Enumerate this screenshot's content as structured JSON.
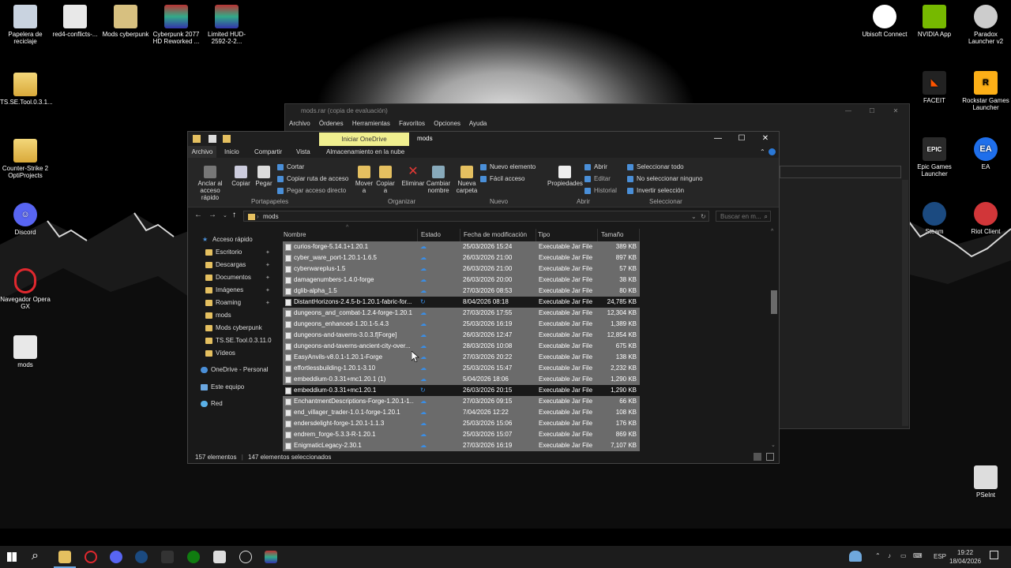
{
  "desktop": {
    "left_icons": [
      {
        "label": "Papelera de reciclaje"
      },
      {
        "label": "red4-conflicts-..."
      },
      {
        "label": "Mods cyberpunk"
      },
      {
        "label": "Cyberpunk 2077 HD Reworked ..."
      },
      {
        "label": "Limited HUD-2592-2-2..."
      },
      {
        "label": "TS.SE.Tool.0.3.1..."
      },
      {
        "label": "Counter-Strike 2 OptiProjects"
      },
      {
        "label": "Discord"
      },
      {
        "label": "Navegador Opera GX"
      },
      {
        "label": "mods"
      }
    ],
    "right_icons": [
      {
        "label": "Ubisoft Connect"
      },
      {
        "label": "NVIDIA App"
      },
      {
        "label": "Paradox Launcher v2"
      },
      {
        "label": "FACEIT"
      },
      {
        "label": "Rockstar Games Launcher"
      },
      {
        "label": "Epic Games Launcher"
      },
      {
        "label": "EA"
      },
      {
        "label": "Steam"
      },
      {
        "label": "Riot Client"
      },
      {
        "label": "PSeInt"
      }
    ]
  },
  "winrar": {
    "title": "mods.rar (copia de evaluación)",
    "menu": [
      "Archivo",
      "Órdenes",
      "Herramientas",
      "Favoritos",
      "Opciones",
      "Ayuda"
    ]
  },
  "explorer": {
    "onedrive_button": "Iniciar OneDrive",
    "title": "mods",
    "tabs": [
      "Archivo",
      "Inicio",
      "Compartir",
      "Vista",
      "Almacenamiento en la nube"
    ],
    "ribbon": {
      "pin": "Anclar al acceso rápido",
      "copy": "Copiar",
      "paste": "Pegar",
      "cut": "Cortar",
      "copy_path": "Copiar ruta de acceso",
      "paste_shortcut": "Pegar acceso directo",
      "move_to": "Mover a",
      "copy_to": "Copiar a",
      "delete": "Eliminar",
      "rename": "Cambiar nombre",
      "new_folder": "Nueva carpeta",
      "new_item": "Nuevo elemento",
      "easy_access": "Fácil acceso",
      "properties": "Propiedades",
      "open": "Abrir",
      "edit": "Editar",
      "history": "Historial",
      "select_all": "Seleccionar todo",
      "select_none": "No seleccionar ninguno",
      "invert_selection": "Invertir selección",
      "groups": [
        "Portapapeles",
        "Organizar",
        "Nuevo",
        "Abrir",
        "Seleccionar"
      ]
    },
    "address": "mods",
    "search_placeholder": "Buscar en m...",
    "nav": [
      {
        "label": "Acceso rápido"
      },
      {
        "label": "Escritorio"
      },
      {
        "label": "Descargas"
      },
      {
        "label": "Documentos"
      },
      {
        "label": "Imágenes"
      },
      {
        "label": "Roaming"
      },
      {
        "label": "mods"
      },
      {
        "label": "Mods cyberpunk"
      },
      {
        "label": "TS.SE.Tool.0.3.11.0"
      },
      {
        "label": "Vídeos"
      },
      {
        "label": "OneDrive - Personal"
      },
      {
        "label": "Este equipo"
      },
      {
        "label": "Red"
      }
    ],
    "columns": [
      "Nombre",
      "Estado",
      "Fecha de modificación",
      "Tipo",
      "Tamaño"
    ],
    "files": [
      {
        "name": "curios-forge-5.14.1+1.20.1",
        "date": "25/03/2026 15:24",
        "type": "Executable Jar File",
        "size": "389 KB",
        "selected": true
      },
      {
        "name": "cyber_ware_port-1.20.1-1.6.5",
        "date": "26/03/2026 21:00",
        "type": "Executable Jar File",
        "size": "897 KB",
        "selected": true
      },
      {
        "name": "cyberwareplus-1.5",
        "date": "26/03/2026 21:00",
        "type": "Executable Jar File",
        "size": "57 KB",
        "selected": true
      },
      {
        "name": "damagenumbers-1.4.0-forge",
        "date": "26/03/2026 20:00",
        "type": "Executable Jar File",
        "size": "38 KB",
        "selected": true
      },
      {
        "name": "dglib-alpha_1.5",
        "date": "27/03/2026 08:53",
        "type": "Executable Jar File",
        "size": "80 KB",
        "selected": true
      },
      {
        "name": "DistantHorizons-2.4.5-b-1.20.1-fabric-for...",
        "date": "8/04/2026 08:18",
        "type": "Executable Jar File",
        "size": "24,785 KB",
        "selected": false
      },
      {
        "name": "dungeons_and_combat-1.2.4-forge-1.20.1",
        "date": "27/03/2026 17:55",
        "type": "Executable Jar File",
        "size": "12,304 KB",
        "selected": true
      },
      {
        "name": "dungeons_enhanced-1.20.1-5.4.3",
        "date": "25/03/2026 16:19",
        "type": "Executable Jar File",
        "size": "1,389 KB",
        "selected": true
      },
      {
        "name": "dungeons-and-taverns-3.0.3.f[Forge]",
        "date": "26/03/2026 12:47",
        "type": "Executable Jar File",
        "size": "12,854 KB",
        "selected": true
      },
      {
        "name": "dungeons-and-taverns-ancient-city-over...",
        "date": "28/03/2026 10:08",
        "type": "Executable Jar File",
        "size": "675 KB",
        "selected": true
      },
      {
        "name": "EasyAnvils-v8.0.1-1.20.1-Forge",
        "date": "27/03/2026 20:22",
        "type": "Executable Jar File",
        "size": "138 KB",
        "selected": true
      },
      {
        "name": "effortlessbuilding-1.20.1-3.10",
        "date": "25/03/2026 15:47",
        "type": "Executable Jar File",
        "size": "2,232 KB",
        "selected": true
      },
      {
        "name": "embeddium-0.3.31+mc1.20.1 (1)",
        "date": "5/04/2026 18:06",
        "type": "Executable Jar File",
        "size": "1,290 KB",
        "selected": true
      },
      {
        "name": "embeddium-0.3.31+mc1.20.1",
        "date": "26/03/2026 20:15",
        "type": "Executable Jar File",
        "size": "1,290 KB",
        "selected": false
      },
      {
        "name": "EnchantmentDescriptions-Forge-1.20.1-1...",
        "date": "27/03/2026 09:15",
        "type": "Executable Jar File",
        "size": "66 KB",
        "selected": true
      },
      {
        "name": "end_villager_trader-1.0.1-forge-1.20.1",
        "date": "7/04/2026 12:22",
        "type": "Executable Jar File",
        "size": "108 KB",
        "selected": true
      },
      {
        "name": "endersdelight-forge-1.20.1-1.1.3",
        "date": "25/03/2026 15:06",
        "type": "Executable Jar File",
        "size": "176 KB",
        "selected": true
      },
      {
        "name": "endrem_forge-5.3.3-R-1.20.1",
        "date": "25/03/2026 15:07",
        "type": "Executable Jar File",
        "size": "869 KB",
        "selected": true
      },
      {
        "name": "EnigmaticLegacy-2.30.1",
        "date": "27/03/2026 16:19",
        "type": "Executable Jar File",
        "size": "7,107 KB",
        "selected": true
      }
    ],
    "status_count": "157 elementos",
    "status_selected": "147 elementos seleccionados"
  },
  "taskbar": {
    "lang": "ESP",
    "time": "19:22",
    "date": "18/04/2026"
  }
}
